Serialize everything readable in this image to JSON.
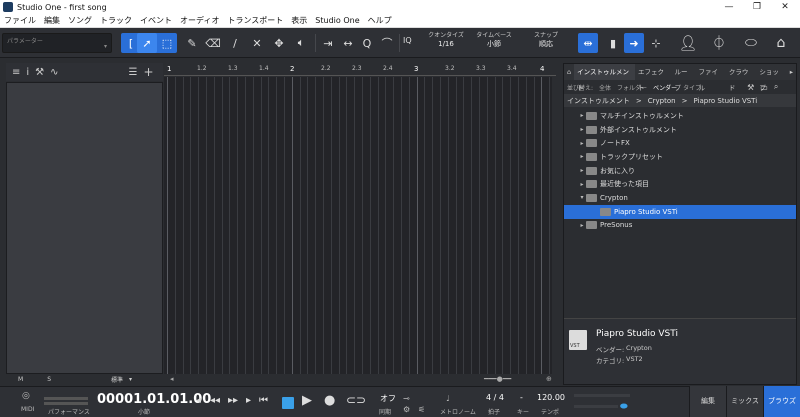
{
  "window": {
    "title": "Studio One - first song",
    "controls": [
      "—",
      "❐",
      "✕"
    ]
  },
  "menu": [
    "ファイル",
    "編集",
    "ソング",
    "トラック",
    "イベント",
    "オーディオ",
    "トランスポート",
    "表示",
    "Studio One",
    "ヘルプ"
  ],
  "toolbar": {
    "parameter_label": "パラメーター",
    "quantize_label": "クオンタイズ",
    "quantize_value": "1/16",
    "timebase_label": "タイムベース",
    "timebase_value": "小節",
    "snap_label": "スナップ",
    "snap_value": "順応",
    "iq_label": "IQ"
  },
  "ruler": {
    "ticks": [
      "1",
      "1.2",
      "1.3",
      "1.4",
      "2",
      "2.2",
      "2.3",
      "2.4",
      "3",
      "3.2",
      "3.3",
      "3.4",
      "4"
    ]
  },
  "inspector": {
    "m_label": "M",
    "s_label": "S",
    "standard_label": "標準"
  },
  "browser": {
    "tabs": [
      "インストゥルメント",
      "エフェクト",
      "ループ",
      "ファイル",
      "クラウド",
      "ショップ"
    ],
    "sort_label": "並び替え:",
    "sort_options": [
      "全体",
      "フォルダー",
      "ベンダー",
      "タイプ"
    ],
    "breadcrumb": [
      "インストゥルメント",
      ">",
      "Crypton",
      ">",
      "Piapro Studio VSTi"
    ],
    "tree": [
      {
        "label": "マルチインストゥルメント",
        "arrow": "▸",
        "indent": 0
      },
      {
        "label": "外部インストゥルメント",
        "arrow": "▸",
        "indent": 0
      },
      {
        "label": "ノートFX",
        "arrow": "▸",
        "indent": 0
      },
      {
        "label": "トラックプリセット",
        "arrow": "▸",
        "indent": 0
      },
      {
        "label": "お気に入り",
        "arrow": "▸",
        "indent": 0
      },
      {
        "label": "最近使った項目",
        "arrow": "▸",
        "indent": 0
      },
      {
        "label": "Crypton",
        "arrow": "▾",
        "indent": 0
      },
      {
        "label": "Piapro Studio VSTi",
        "arrow": "",
        "indent": 1,
        "selected": true
      },
      {
        "label": "PreSonus",
        "arrow": "▸",
        "indent": 0
      }
    ],
    "info": {
      "name": "Piapro Studio VSTi",
      "vendor_label": "ベンダー:",
      "vendor": "Crypton",
      "category_label": "カテゴリ:",
      "category": "VST2",
      "vst_badge": "VST"
    }
  },
  "transport": {
    "midi_label": "MIDI",
    "performance_label": "パフォーマンス",
    "time": "00001.01.01.00",
    "time_unit": "小節",
    "sync_label": "オフ",
    "sync_sub": "同期",
    "metronome_label": "メトロノーム",
    "timesig": "4 / 4",
    "timesig_sub": "拍子",
    "key_label": "-",
    "key_sub": "キー",
    "tempo": "120.00",
    "tempo_sub": "テンポ"
  },
  "pages": [
    "編集",
    "ミックス",
    "ブラウズ"
  ],
  "colors": {
    "accent": "#2a6fd8",
    "background": "#2b2d31",
    "loop": "#3aa0e8"
  }
}
